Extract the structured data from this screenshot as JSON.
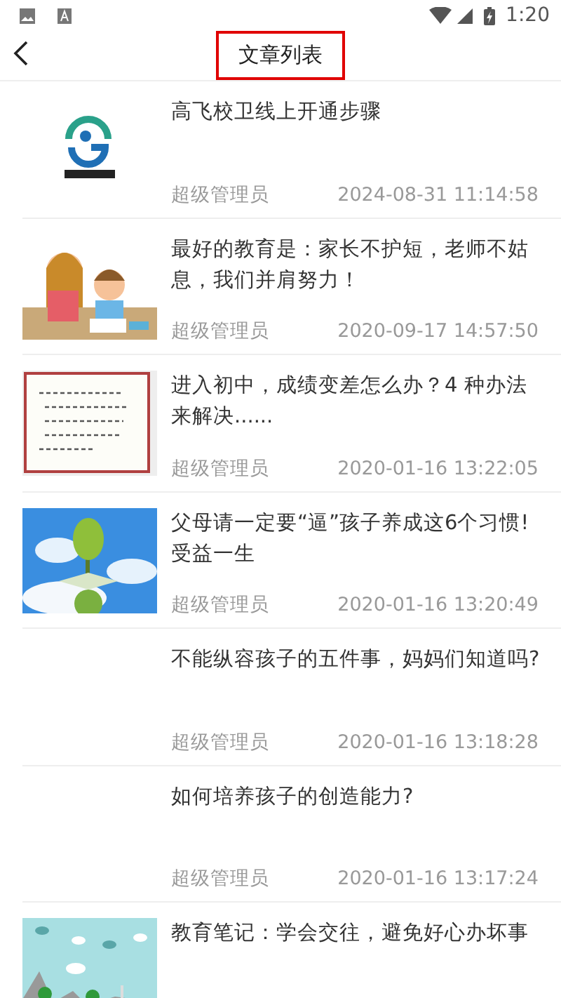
{
  "status_bar": {
    "time": "1:20"
  },
  "header": {
    "title": "文章列表",
    "highlighted": true
  },
  "articles": [
    {
      "kind": "picture",
      "title": "高飞校卫线上开通步骤",
      "author": "超级管理员",
      "date": "2024-08-31 11:14:58"
    },
    {
      "kind": "picture",
      "title": "最好的教育是：家长不护短，老师不姑息，我们并肩努力！",
      "author": "超级管理员",
      "date": "2020-09-17 14:57:50"
    },
    {
      "kind": "picture",
      "title": "进入初中，成绩变差怎么办？4 种办法来解决......",
      "author": "超级管理员",
      "date": "2020-01-16 13:22:05"
    },
    {
      "kind": "picture",
      "title": "父母请一定要“逼”孩子养成这6个习惯!受益一生",
      "author": "超级管理员",
      "date": "2020-01-16 13:20:49"
    },
    {
      "kind": "text",
      "title": "不能纵容孩子的五件事，妈妈们知道吗?",
      "author": "超级管理员",
      "date": "2020-01-16 13:18:28"
    },
    {
      "kind": "text",
      "title": "如何培养孩子的创造能力?",
      "author": "超级管理员",
      "date": "2020-01-16 13:17:24"
    },
    {
      "kind": "picture",
      "title": "教育笔记：学会交往，避免好心办坏事"
    }
  ]
}
